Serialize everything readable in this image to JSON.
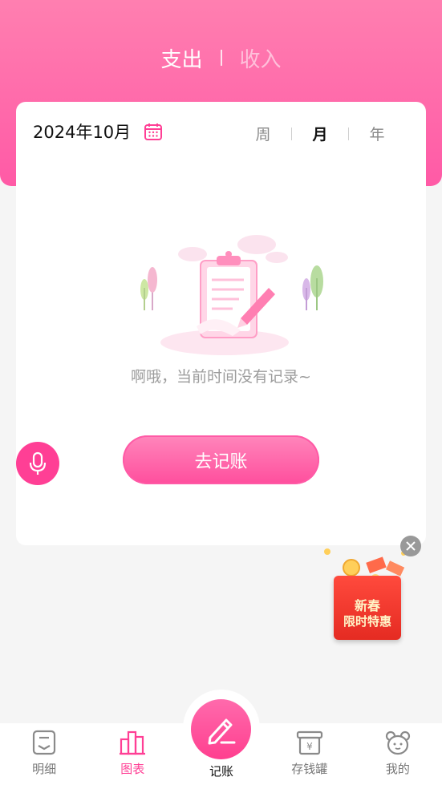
{
  "header": {
    "tabs": [
      {
        "label": "支出",
        "active": true
      },
      {
        "label": "收入",
        "active": false
      }
    ]
  },
  "card": {
    "date": "2024年10月",
    "periods": [
      {
        "label": "周",
        "active": false
      },
      {
        "label": "月",
        "active": true
      },
      {
        "label": "年",
        "active": false
      }
    ],
    "empty_text": "啊哦，当前时间没有记录~",
    "go_button": "去记账"
  },
  "promo": {
    "line1": "新春",
    "line2": "限时特惠"
  },
  "tabbar": {
    "items": [
      {
        "label": "明细",
        "icon": "detail-icon"
      },
      {
        "label": "图表",
        "icon": "chart-icon"
      },
      {
        "label": "记账",
        "icon": "pen-icon"
      },
      {
        "label": "存钱罐",
        "icon": "piggy-bank-icon"
      },
      {
        "label": "我的",
        "icon": "profile-icon"
      }
    ]
  },
  "colors": {
    "accent": "#ff5aa6",
    "primary_pink": "#ff3f95"
  }
}
